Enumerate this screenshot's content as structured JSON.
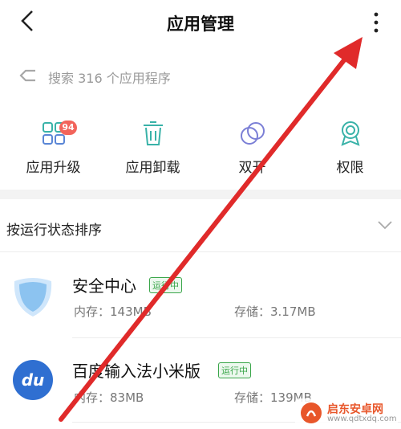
{
  "header": {
    "title": "应用管理"
  },
  "search": {
    "placeholder": "搜索 316 个应用程序"
  },
  "quick_actions": [
    {
      "label": "应用升级",
      "icon": "apps-grid-icon",
      "badge": "94"
    },
    {
      "label": "应用卸载",
      "icon": "trash-icon"
    },
    {
      "label": "双开",
      "icon": "dual-circles-icon"
    },
    {
      "label": "权限",
      "icon": "badge-ribbon-icon"
    }
  ],
  "sort": {
    "label": "按运行状态排序"
  },
  "apps": [
    {
      "name": "安全中心",
      "status": "运行中",
      "memory": "内存：143MB",
      "storage": "存储：3.17MB",
      "icon": "shield-icon"
    },
    {
      "name": "百度输入法小米版",
      "status": "运行中",
      "memory": "内存：83MB",
      "storage": "存储：139MB",
      "icon": "du-logo-icon"
    }
  ],
  "watermark": {
    "text": "启东安卓网",
    "url": "www.qdtxdq.com"
  },
  "colors": {
    "accent": "#3aa64a",
    "badge": "#f2645b",
    "arrow": "#e02a2a"
  }
}
